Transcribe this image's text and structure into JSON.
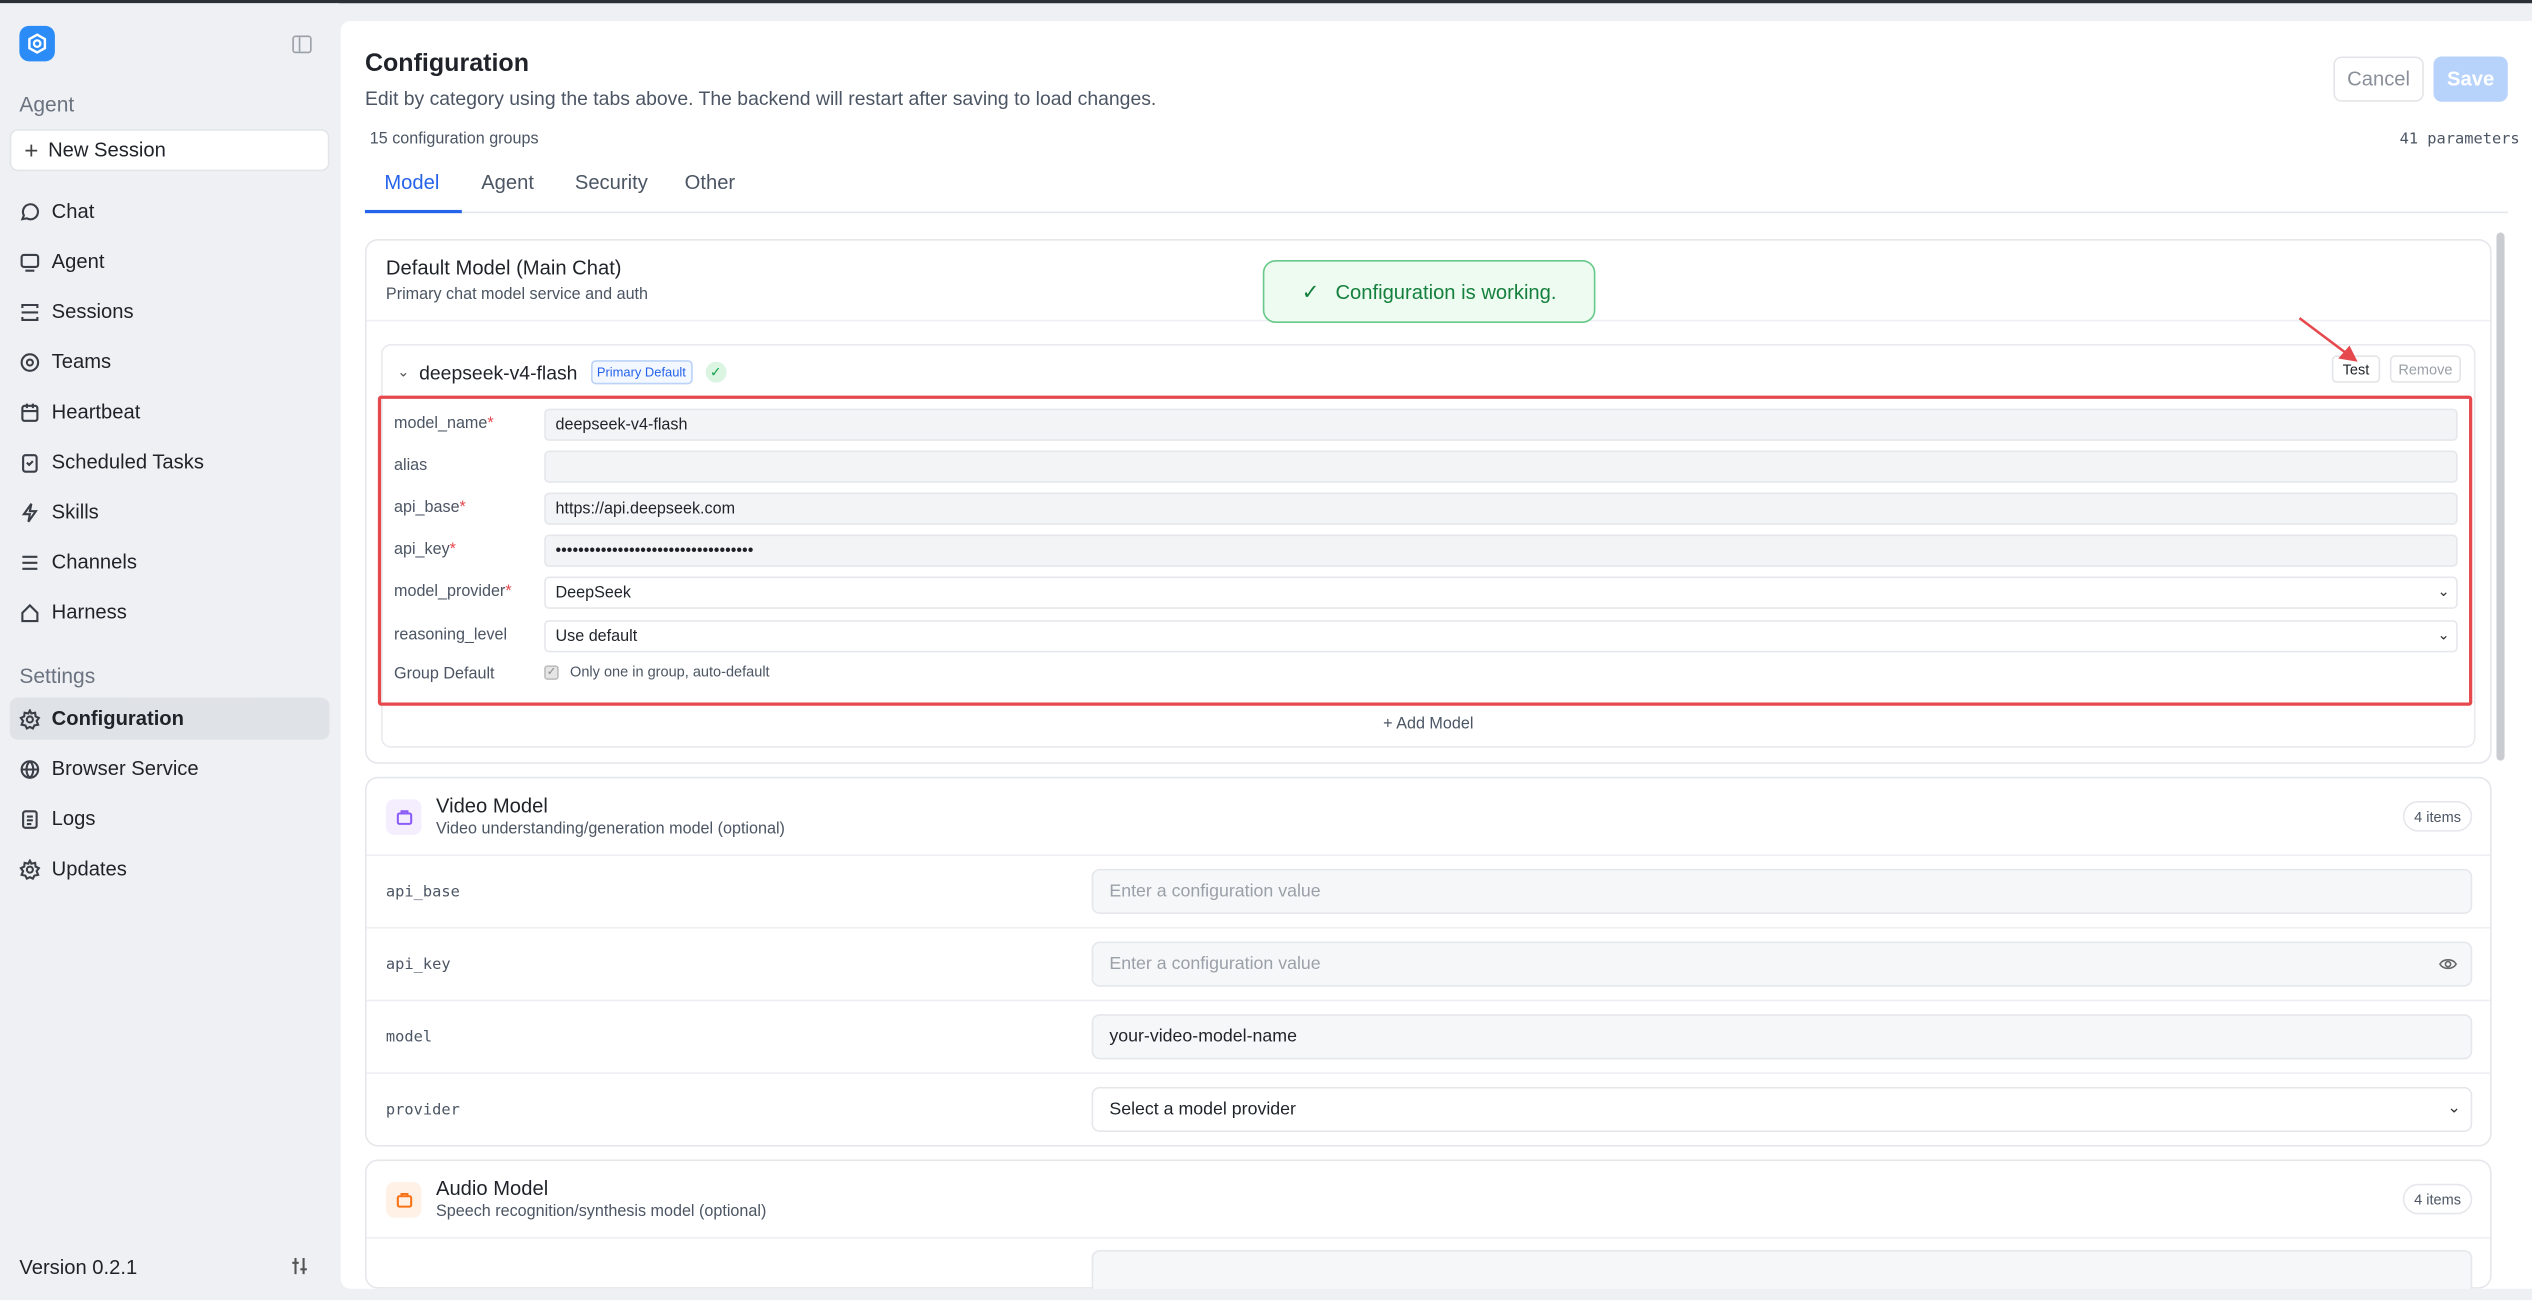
{
  "sidebar": {
    "agent_heading": "Agent",
    "new_session": "New Session",
    "items": [
      {
        "label": "Chat",
        "icon": "chat-icon"
      },
      {
        "label": "Agent",
        "icon": "monitor-icon"
      },
      {
        "label": "Sessions",
        "icon": "sessions-icon"
      },
      {
        "label": "Teams",
        "icon": "teams-icon"
      },
      {
        "label": "Heartbeat",
        "icon": "calendar-icon"
      },
      {
        "label": "Scheduled Tasks",
        "icon": "clipboard-icon"
      },
      {
        "label": "Skills",
        "icon": "bolt-icon"
      },
      {
        "label": "Channels",
        "icon": "list-icon"
      },
      {
        "label": "Harness",
        "icon": "home-icon"
      }
    ],
    "settings_heading": "Settings",
    "settings_items": [
      {
        "label": "Configuration",
        "icon": "gear-icon"
      },
      {
        "label": "Browser Service",
        "icon": "globe-icon"
      },
      {
        "label": "Logs",
        "icon": "document-icon"
      },
      {
        "label": "Updates",
        "icon": "gear-icon"
      }
    ],
    "version": "Version 0.2.1"
  },
  "header": {
    "title": "Configuration",
    "subtitle": "Edit by category using the tabs above. The backend will restart after saving to load changes.",
    "cancel": "Cancel",
    "save": "Save",
    "groups": "15 configuration groups",
    "params": "41 parameters"
  },
  "tabs": [
    "Model",
    "Agent",
    "Security",
    "Other"
  ],
  "toast": "Configuration is working.",
  "default_model": {
    "title": "Default Model (Main Chat)",
    "desc": "Primary chat model service and auth",
    "model_name": "deepseek-v4-flash",
    "badge": "Primary Default",
    "test": "Test",
    "remove": "Remove",
    "fields": {
      "model_name_label": "model_name",
      "model_name_value": "deepseek-v4-flash",
      "alias_label": "alias",
      "alias_value": "",
      "api_base_label": "api_base",
      "api_base_value": "https://api.deepseek.com",
      "api_key_label": "api_key",
      "api_key_value": "•••••••••••••••••••••••••••••••••••",
      "provider_label": "model_provider",
      "provider_value": "DeepSeek",
      "reasoning_label": "reasoning_level",
      "reasoning_value": "Use default",
      "group_label": "Group Default",
      "group_value": "Only one in group, auto-default"
    },
    "add_model": "+ Add Model"
  },
  "video_model": {
    "title": "Video Model",
    "desc": "Video understanding/generation model (optional)",
    "items": "4 items",
    "rows": [
      {
        "key": "api_base",
        "value": "Enter a configuration value"
      },
      {
        "key": "api_key",
        "value": "Enter a configuration value"
      },
      {
        "key": "model",
        "value": "your-video-model-name"
      },
      {
        "key": "provider",
        "value": "Select a model provider"
      }
    ]
  },
  "audio_model": {
    "title": "Audio Model",
    "desc": "Speech recognition/synthesis model (optional)",
    "items": "4 items"
  },
  "colors": {
    "accent": "#2563eb",
    "highlight": "#e5484d",
    "success": "#15803d"
  }
}
